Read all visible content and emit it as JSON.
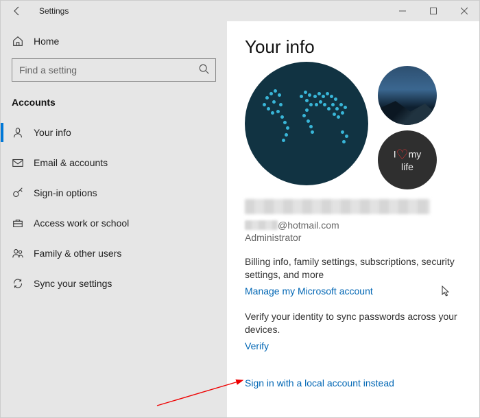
{
  "window": {
    "title": "Settings"
  },
  "sidebar": {
    "home_label": "Home",
    "search_placeholder": "Find a setting",
    "section": "Accounts",
    "items": [
      {
        "label": "Your info",
        "icon": "person-icon",
        "active": true
      },
      {
        "label": "Email & accounts",
        "icon": "mail-icon",
        "active": false
      },
      {
        "label": "Sign-in options",
        "icon": "key-icon",
        "active": false
      },
      {
        "label": "Access work or school",
        "icon": "briefcase-icon",
        "active": false
      },
      {
        "label": "Family & other users",
        "icon": "people-icon",
        "active": false
      },
      {
        "label": "Sync your settings",
        "icon": "sync-icon",
        "active": false
      }
    ]
  },
  "content": {
    "heading": "Your info",
    "email_suffix": "@hotmail.com",
    "role": "Administrator",
    "billing_text": "Billing info, family settings, subscriptions, security settings, and more",
    "manage_link": "Manage my Microsoft account",
    "verify_text": "Verify your identity to sync passwords across your devices.",
    "verify_link": "Verify",
    "local_link": "Sign in with a local account instead",
    "avatar_small2_text_prefix": "I",
    "avatar_small2_text_my": "my",
    "avatar_small2_text_life": "life"
  }
}
